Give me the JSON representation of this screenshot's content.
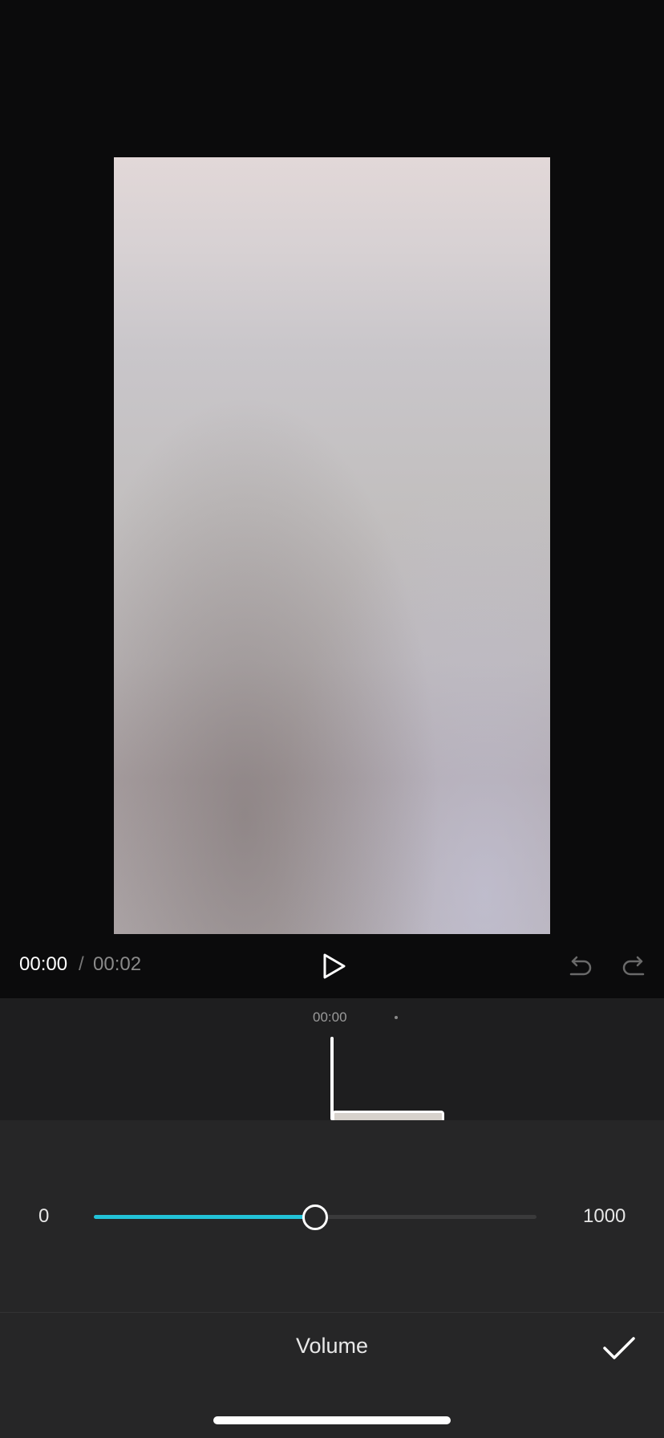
{
  "player": {
    "current_time": "00:00",
    "separator": "/",
    "total_time": "00:02"
  },
  "icons": {
    "play": "play-icon",
    "undo": "undo-icon",
    "redo": "redo-icon",
    "confirm": "check-icon"
  },
  "timeline": {
    "timestamp": "00:00"
  },
  "volume_slider": {
    "min_label": "0",
    "max_label": "1000",
    "value_fraction": 0.5
  },
  "panel": {
    "title": "Volume"
  },
  "colors": {
    "accent": "#22c3d8",
    "background": "#0b0b0c",
    "panel": "#262627"
  }
}
